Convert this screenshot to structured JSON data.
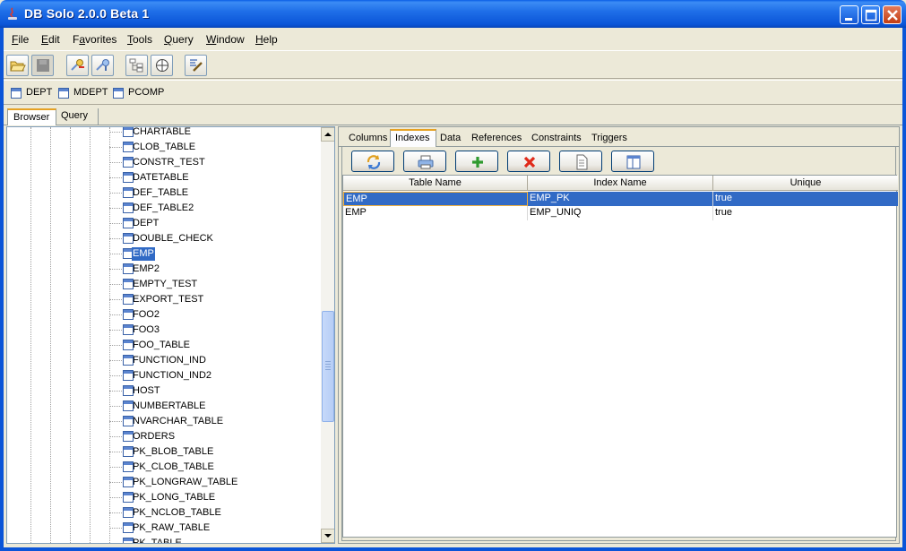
{
  "window": {
    "title": "DB Solo  2.0.0 Beta 1"
  },
  "menu": [
    {
      "label": "File",
      "mnemonic": "F",
      "rest": "ile"
    },
    {
      "label": "Edit",
      "mnemonic": "E",
      "rest": "dit"
    },
    {
      "label": "Favorites",
      "pre": "F",
      "mnemonic": "a",
      "rest": "vorites"
    },
    {
      "label": "Tools",
      "mnemonic": "T",
      "rest": "ools"
    },
    {
      "label": "Query",
      "mnemonic": "Q",
      "rest": "uery"
    },
    {
      "label": "Window",
      "mnemonic": "W",
      "rest": "indow"
    },
    {
      "label": "Help",
      "mnemonic": "H",
      "rest": "elp"
    }
  ],
  "favorites": [
    "DEPT",
    "MDEPT",
    "PCOMP"
  ],
  "main_tabs": [
    "Browser",
    "Query"
  ],
  "tree": {
    "items": [
      "CHARTABLE",
      "CLOB_TABLE",
      "CONSTR_TEST",
      "DATETABLE",
      "DEF_TABLE",
      "DEF_TABLE2",
      "DEPT",
      "DOUBLE_CHECK",
      "EMP",
      "EMP2",
      "EMPTY_TEST",
      "EXPORT_TEST",
      "FOO2",
      "FOO3",
      "FOO_TABLE",
      "FUNCTION_IND",
      "FUNCTION_IND2",
      "HOST",
      "NUMBERTABLE",
      "NVARCHAR_TABLE",
      "ORDERS",
      "PK_BLOB_TABLE",
      "PK_CLOB_TABLE",
      "PK_LONGRAW_TABLE",
      "PK_LONG_TABLE",
      "PK_NCLOB_TABLE",
      "PK_RAW_TABLE",
      "PK_TABLE"
    ],
    "selected": "EMP"
  },
  "detail_tabs": [
    "Columns",
    "Indexes",
    "Data",
    "References",
    "Constraints",
    "Triggers"
  ],
  "detail_active": "Indexes",
  "grid": {
    "columns": [
      "Table Name",
      "Index Name",
      "Unique"
    ],
    "rows": [
      [
        "EMP",
        "EMP_PK",
        "true"
      ],
      [
        "EMP",
        "EMP_UNIQ",
        "true"
      ]
    ]
  },
  "colors": {
    "titlebar": "#0b55d8",
    "selection": "#316ac5",
    "tab_accent": "#e6a224"
  }
}
